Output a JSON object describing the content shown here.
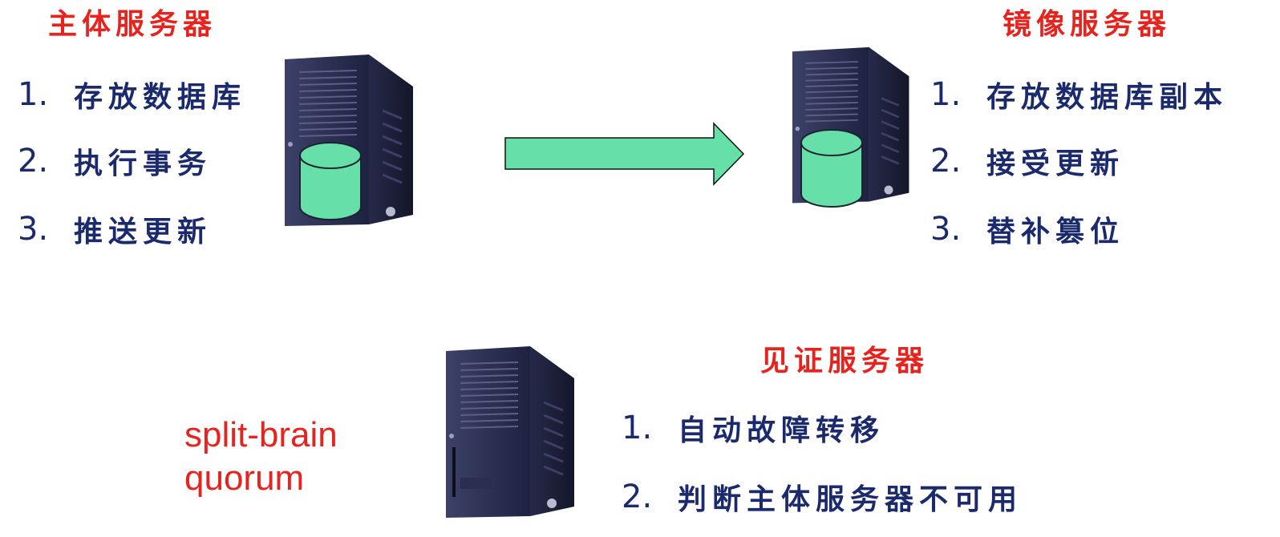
{
  "principal": {
    "title": "主体服务器",
    "items": [
      {
        "num": "1.",
        "text": "存放数据库"
      },
      {
        "num": "2.",
        "text": "执行事务"
      },
      {
        "num": "3.",
        "text": "推送更新"
      }
    ]
  },
  "mirror": {
    "title": "镜像服务器",
    "items": [
      {
        "num": "1.",
        "text": "存放数据库副本"
      },
      {
        "num": "2.",
        "text": "接受更新"
      },
      {
        "num": "3.",
        "text": "替补篡位"
      }
    ]
  },
  "witness": {
    "title": "见证服务器",
    "items": [
      {
        "num": "1.",
        "text": "自动故障转移"
      },
      {
        "num": "2.",
        "text": "判断主体服务器不可用"
      }
    ]
  },
  "notes": {
    "line1": "split-brain",
    "line2": "quorum"
  },
  "colors": {
    "title": "#e8231e",
    "list_text": "#1a2a6c",
    "arrow": "#66dfa8",
    "database": "#66dfa8"
  }
}
